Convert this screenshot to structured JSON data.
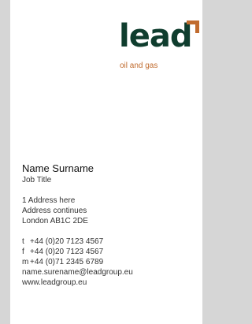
{
  "brand": {
    "logo_text": "lead",
    "tagline": "oil and gas",
    "logo_color": "#0f3d2e",
    "accent_color": "#c06b2e"
  },
  "person": {
    "name": "Name Surname",
    "title": "Job Title"
  },
  "address": {
    "line1": "1 Address here",
    "line2": "Address continues",
    "line3": "London AB1C 2DE"
  },
  "contact": {
    "tel_label": "t",
    "tel": "+44 (0)20 7123 4567",
    "fax_label": "f",
    "fax": "+44 (0)20 7123 4567",
    "mobile_label": "m",
    "mobile": "+44 (0)71 2345 6789",
    "email": "name.surename@leadgroup.eu",
    "website": "www.leadgroup.eu"
  }
}
